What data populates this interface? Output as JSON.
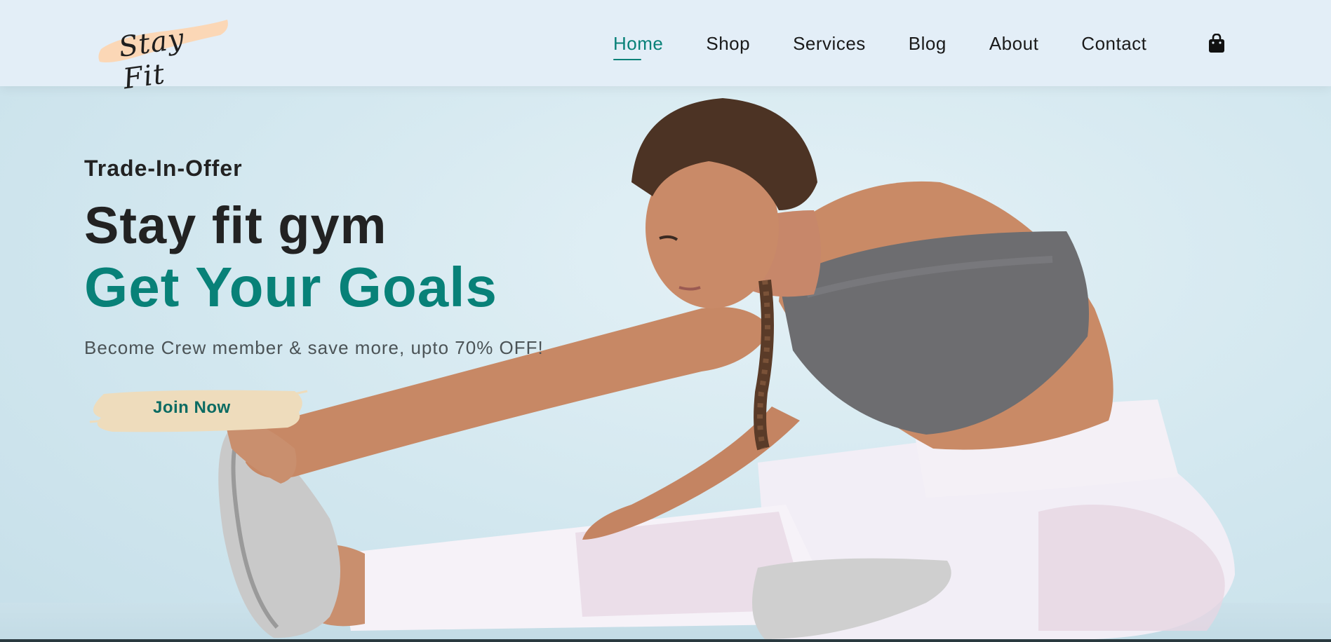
{
  "logo": {
    "text": "Stay Fit"
  },
  "nav": {
    "items": [
      {
        "label": "Home",
        "active": true
      },
      {
        "label": "Shop",
        "active": false
      },
      {
        "label": "Services",
        "active": false
      },
      {
        "label": "Blog",
        "active": false
      },
      {
        "label": "About",
        "active": false
      },
      {
        "label": "Contact",
        "active": false
      }
    ],
    "cart_icon": "shopping-bag-icon"
  },
  "hero": {
    "eyebrow": "Trade-In-Offer",
    "headline_line1": "Stay fit gym",
    "headline_line2": "Get Your Goals",
    "subtext": "Become Crew member & save more, upto 70% OFF!",
    "cta_label": "Join Now"
  },
  "colors": {
    "accent": "#088178",
    "brush_logo": "#fbd7b6",
    "brush_button": "#eedcbc",
    "header_bg": "#e3eef7",
    "hero_bg": "#d3e8f0"
  }
}
